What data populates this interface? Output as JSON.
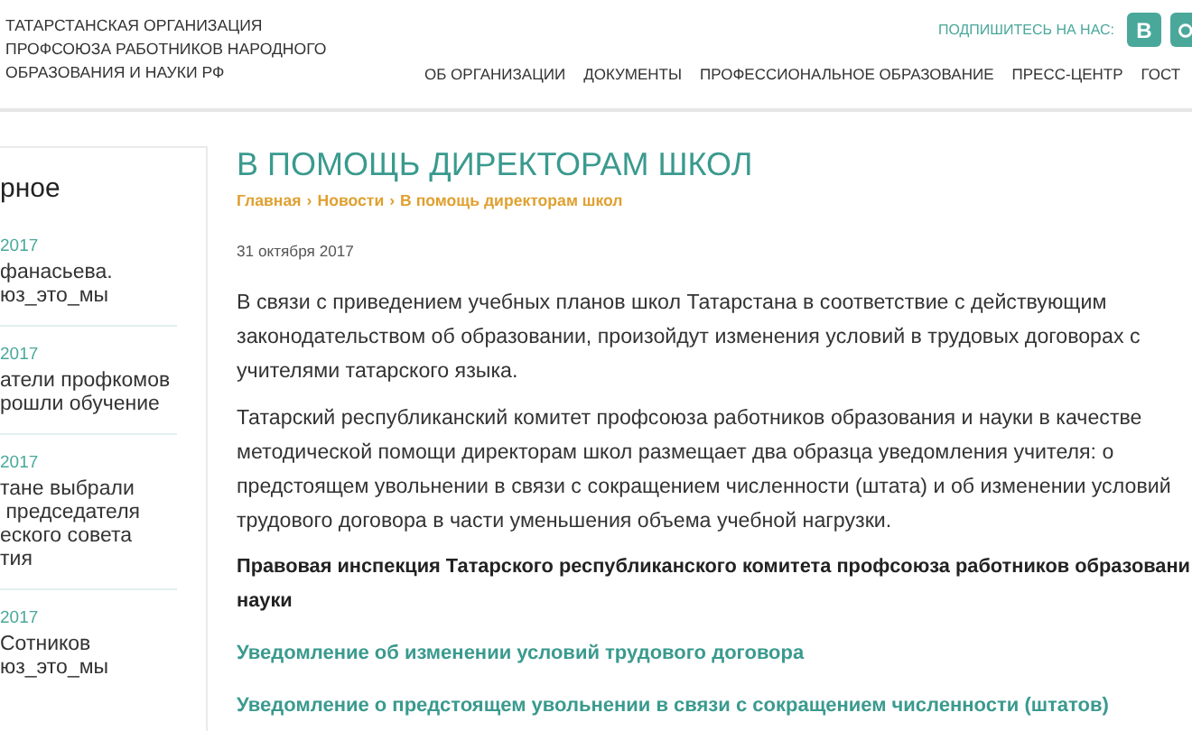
{
  "header": {
    "org_name": "ТАТАРСТАНСКАЯ ОРГАНИЗАЦИЯ\nПРОФСОЮЗА РАБОТНИКОВ НАРОДНОГО\nОБРАЗОВАНИЯ И НАУКИ РФ",
    "subscribe_label": "ПОДПИШИТЕСЬ НА НАС:",
    "social": [
      {
        "kind": "vk",
        "label": "В"
      },
      {
        "kind": "instagram"
      }
    ],
    "nav": [
      {
        "label": "ОБ ОРГАНИЗАЦИИ"
      },
      {
        "label": "ДОКУМЕНТЫ"
      },
      {
        "label": "ПРОФЕССИОНАЛЬНОЕ ОБРАЗОВАНИЕ"
      },
      {
        "label": "ПРЕСС-ЦЕНТР"
      },
      {
        "label": "ГОСТ"
      }
    ]
  },
  "sidebar": {
    "heading": "рное",
    "items": [
      {
        "date": "2017",
        "title": "фанасьева.\nюз_это_мы"
      },
      {
        "date": "2017",
        "title": "атели профкомов\nрошли обучение"
      },
      {
        "date": "2017",
        "title": "тане выбрали\n председателя\nеского совета\nтия"
      },
      {
        "date": "2017",
        "title": "Сотников\nюз_это_мы"
      }
    ]
  },
  "article": {
    "title": "В ПОМОЩЬ ДИРЕКТОРАМ ШКОЛ",
    "breadcrumbs": [
      "Главная",
      "›",
      "Новости",
      "›",
      "В помощь директорам школ"
    ],
    "date": "31 октября 2017",
    "blocks": [
      {
        "kind": "paragraph",
        "text": "В связи с приведением учебных планов школ Татарстана в соответствие с действующим\nзаконодательством об образовании, произойдут изменения условий в трудовых договорах с\nучителями татарского языка."
      },
      {
        "kind": "paragraph",
        "text": "Татарский республиканский комитет профсоюза работников образования и науки в качестве\nметодической помощи директорам школ размещает два образца уведомления учителя: о\nпредстоящем увольнении в связи с сокращением численности (штата) и об изменении условий\nтрудового договора в части уменьшения объема учебной нагрузки."
      },
      {
        "kind": "bold",
        "text": "Правовая инспекция Татарского республиканского комитета профсоюза работников образовани\nнауки"
      },
      {
        "kind": "link",
        "text": "Уведомление об изменении условий трудового договора"
      },
      {
        "kind": "link",
        "text": "Уведомление о предстоящем увольнении в связи с сокращением численности (штатов)"
      }
    ]
  }
}
